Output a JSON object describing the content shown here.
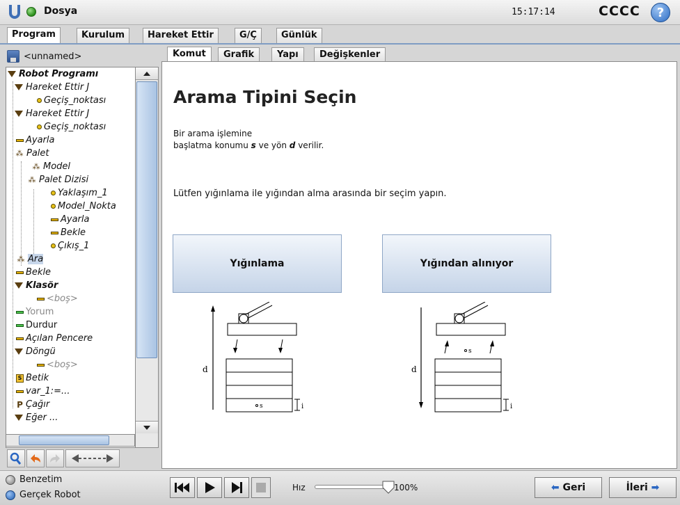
{
  "header": {
    "file_menu": "Dosya",
    "clock": "15:17:14",
    "robot_name": "CCCC",
    "help": "?"
  },
  "main_tabs": [
    "Program",
    "Kurulum",
    "Hareket Ettir",
    "G/Ç",
    "Günlük"
  ],
  "sidebar": {
    "program_name": "<unnamed>",
    "tree": [
      {
        "label": "Robot Programı",
        "icon": "triangle-down-icon"
      },
      {
        "label": "Hareket Ettir J",
        "icon": "triangle-down-icon"
      },
      {
        "label": "Geçiş_noktası",
        "icon": "waypoint-icon"
      },
      {
        "label": "Hareket Ettir J",
        "icon": "triangle-down-icon"
      },
      {
        "label": "Geçiş_noktası",
        "icon": "waypoint-icon"
      },
      {
        "label": "Ayarla",
        "icon": "set-icon"
      },
      {
        "label": "Palet",
        "icon": "pallet-icon"
      },
      {
        "label": "Model",
        "icon": "pallet-icon"
      },
      {
        "label": "Palet Dizisi",
        "icon": "pallet-icon"
      },
      {
        "label": "Yaklaşım_1",
        "icon": "waypoint-icon"
      },
      {
        "label": "Model_Nokta",
        "icon": "waypoint-icon"
      },
      {
        "label": "Ayarla",
        "icon": "set-icon"
      },
      {
        "label": "Bekle",
        "icon": "wait-icon"
      },
      {
        "label": "Çıkış_1",
        "icon": "waypoint-icon"
      },
      {
        "label": "Ara",
        "icon": "pallet-icon"
      },
      {
        "label": "Bekle",
        "icon": "wait-icon"
      },
      {
        "label": "Klasör",
        "icon": "triangle-down-icon"
      },
      {
        "label": "<boş>",
        "icon": "empty-icon"
      },
      {
        "label": "Yorum",
        "icon": "comment-icon"
      },
      {
        "label": "Durdur",
        "icon": "halt-icon"
      },
      {
        "label": "Açılan Pencere",
        "icon": "popup-icon"
      },
      {
        "label": "Döngü",
        "icon": "triangle-down-icon"
      },
      {
        "label": "<boş>",
        "icon": "empty-icon"
      },
      {
        "label": "Betik",
        "icon": "script-icon"
      },
      {
        "label": "var_1:=...",
        "icon": "assignment-icon"
      },
      {
        "label": "Çağır",
        "icon": "call-icon"
      },
      {
        "label": "Eğer ...",
        "icon": "triangle-down-icon"
      }
    ]
  },
  "sub_tabs": [
    "Komut",
    "Grafik",
    "Yapı",
    "Değişkenler"
  ],
  "command": {
    "title": "Arama Tipini Seçin",
    "desc_line1": "Bir arama işlemine",
    "desc_line2_pre": "başlatma konumu ",
    "desc_s": "s",
    "desc_mid": " ve yön ",
    "desc_d": "d",
    "desc_post": " verilir.",
    "prompt": "Lütfen yığınlama ile yığından alma arasında bir seçim yapın.",
    "stack_button": "Yığınlama",
    "destack_button": "Yığından alınıyor",
    "diagram_d": "d",
    "diagram_s": "s",
    "diagram_i": "i"
  },
  "footer": {
    "simulation": "Benzetim",
    "real_robot": "Gerçek Robot",
    "speed_label": "Hız",
    "speed_value": "100%",
    "speed_fraction": 1.0,
    "back_button": "Geri",
    "next_button": "İleri"
  }
}
